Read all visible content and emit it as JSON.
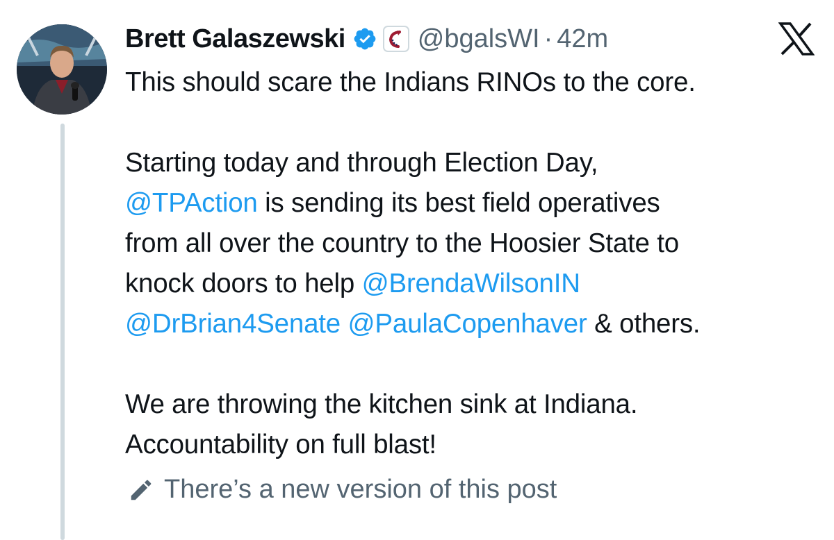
{
  "author": {
    "display_name": "Brett Galaszewski",
    "handle": "@bgalsWI",
    "separator": "·",
    "time_ago": "42m",
    "verified_icon": "verified-badge-icon",
    "affiliate_icon": "organization-affiliate-icon"
  },
  "platform_logo": "x-logo-icon",
  "post": {
    "line1": "This should scare the Indians RINOs to the core.",
    "line2": "Starting today and through Election Day,",
    "line3_mention": "@TPAction",
    "line3_rest": " is sending its best field operatives",
    "line4": "from all over the country to the Hoosier State to",
    "line5_text": "knock doors to help ",
    "line5_mention": "@BrendaWilsonIN",
    "line6_mention1": "@DrBrian4Senate",
    "line6_space": " ",
    "line6_mention2": "@PaulaCopenhaver",
    "line6_rest": " & others.",
    "line7": "We are throwing the kitchen sink at Indiana.",
    "line8": "Accountability on full blast!"
  },
  "edit_notice": {
    "icon": "pencil-icon",
    "label": "There’s a new version of this post"
  },
  "colors": {
    "text": "#0f1419",
    "secondary": "#536471",
    "link": "#1d9bf0",
    "verified": "#1d9bf0",
    "thread_line": "#cfd9de"
  }
}
